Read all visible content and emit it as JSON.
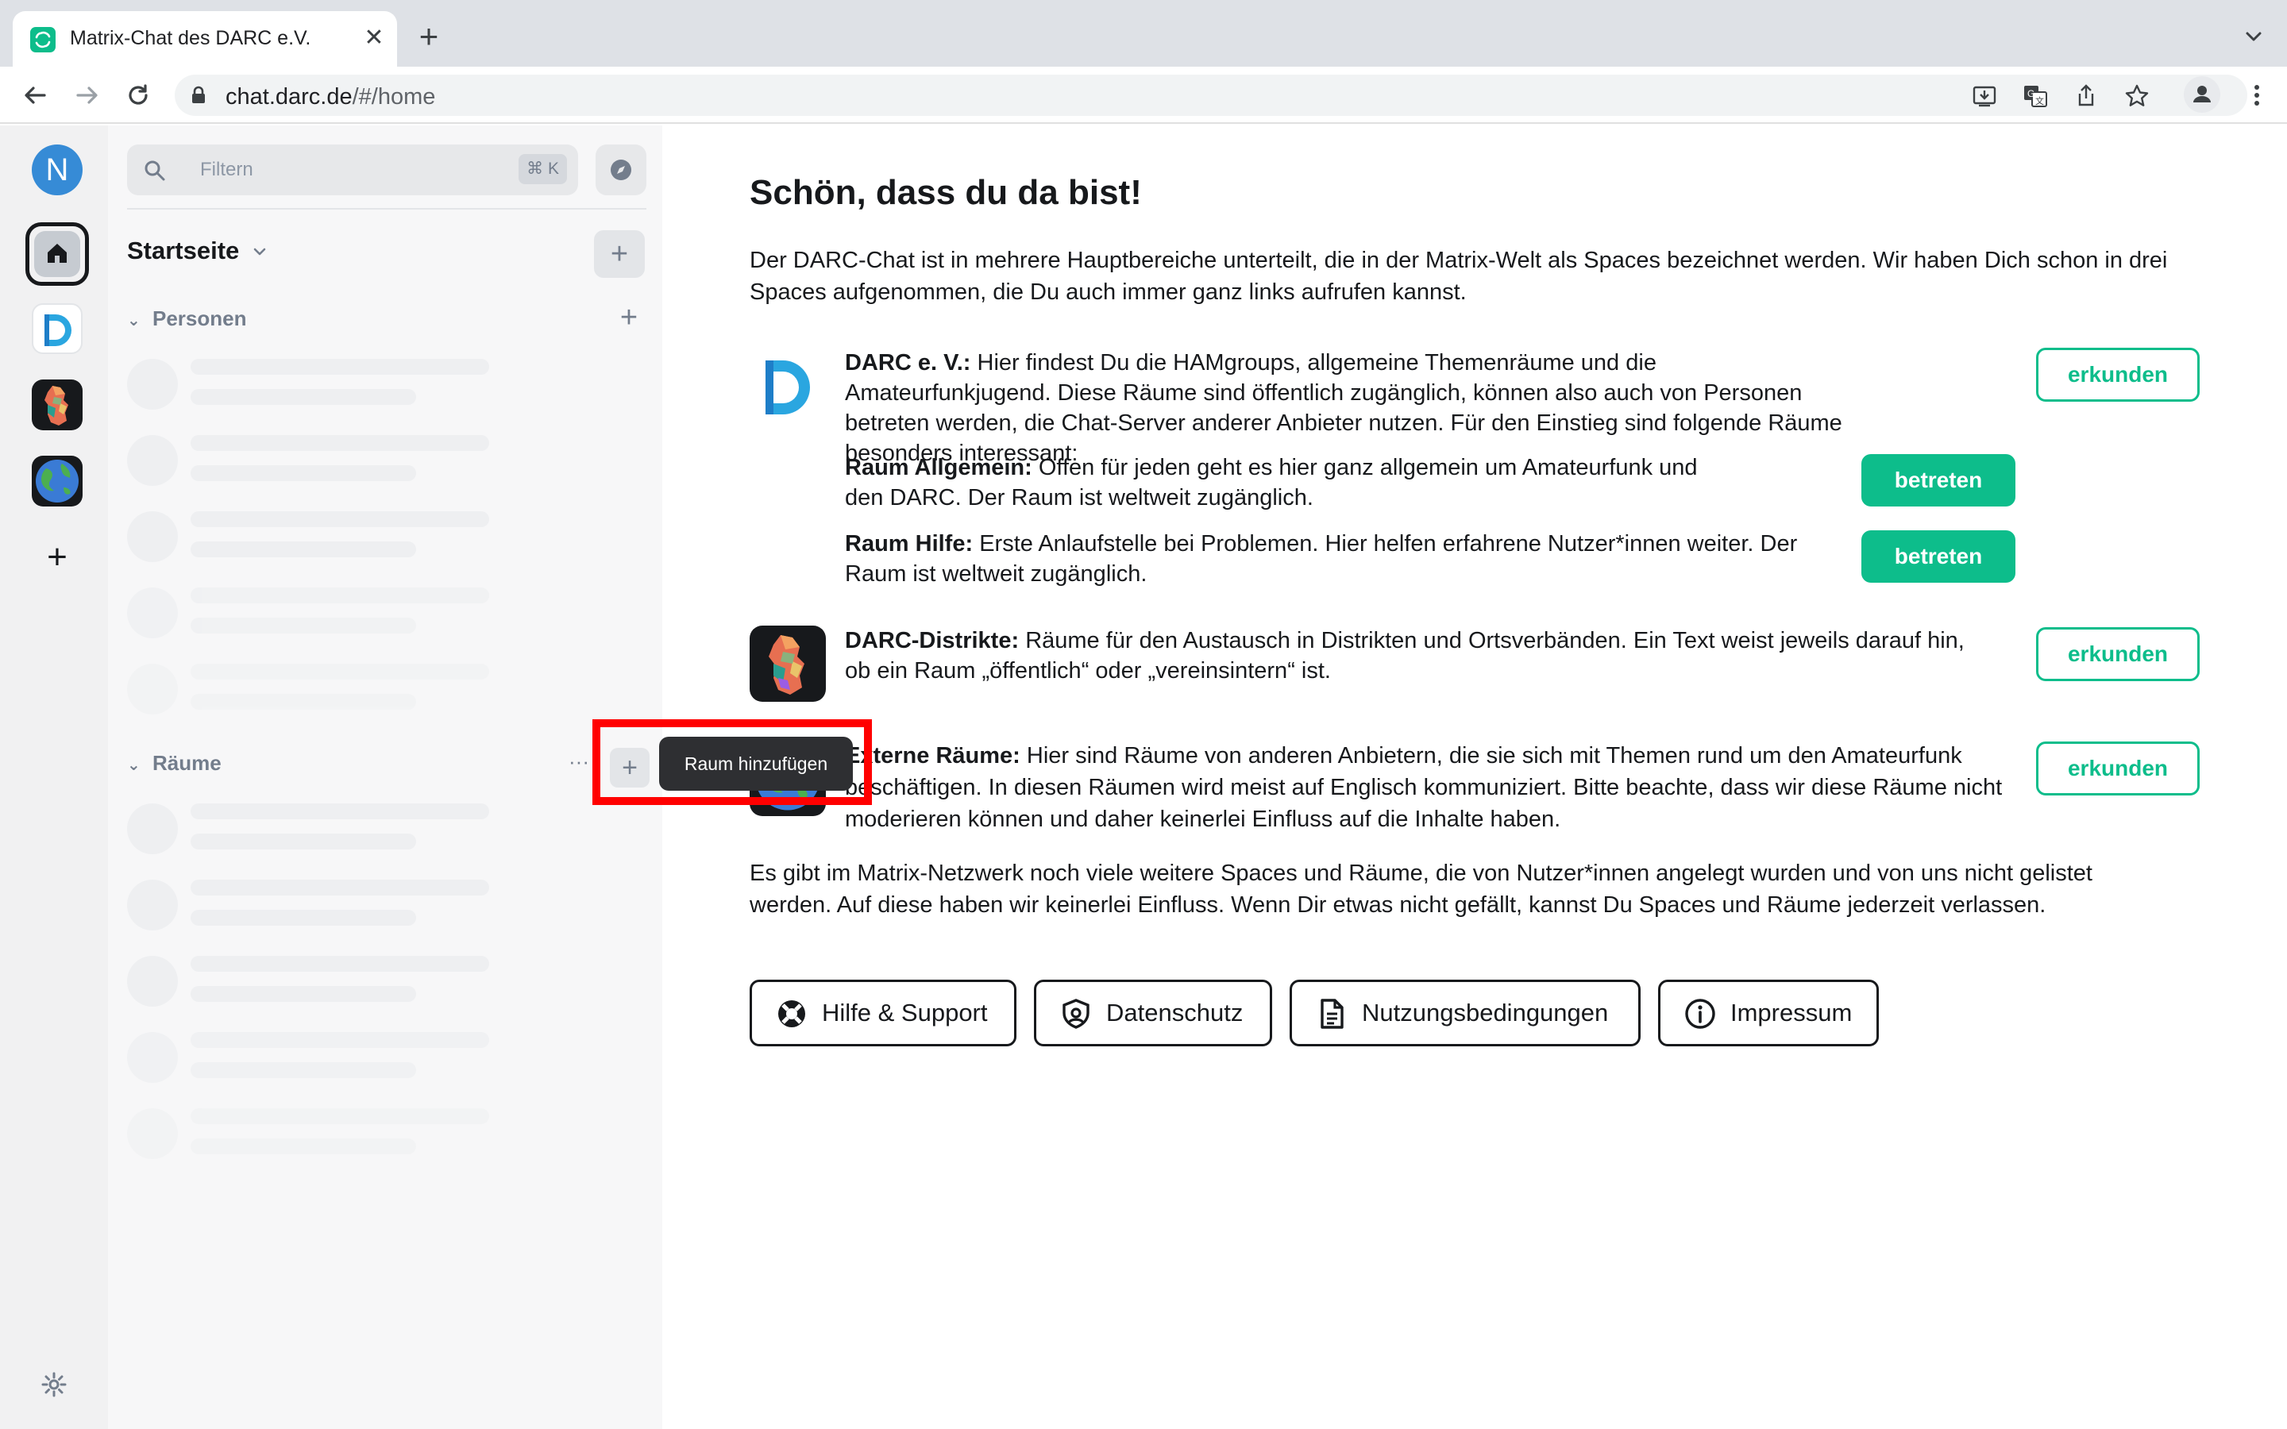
{
  "browser": {
    "tab_title": "Matrix-Chat des DARC e.V.",
    "tab_close": "✕",
    "new_tab": "+",
    "url_host": "chat.darc.de",
    "url_path": "/#/home"
  },
  "spacebar": {
    "user_initial": "N",
    "add_space": "+"
  },
  "roomlist": {
    "filter_placeholder": "Filtern",
    "filter_shortcut": "⌘ K",
    "home_title": "Startseite",
    "home_add": "+",
    "people_label": "Personen",
    "people_add": "+",
    "rooms_label": "Räume",
    "rooms_more": "···",
    "rooms_add": "+",
    "tooltip": "Raum hinzufügen"
  },
  "home": {
    "title": "Schön, dass du da bist!",
    "intro": "Der DARC-Chat ist in mehrere Hauptbereiche unterteilt, die in der Matrix-Welt als Spaces bezeichnet werden. Wir haben Dich schon in drei Spaces aufgenommen, die Du auch immer ganz links aufrufen kannst.",
    "darc": {
      "heading": "DARC e. V.:",
      "text": " Hier findest Du die HAMgroups, allgemeine Themenräume und die Amateurfunkjugend. Diese Räume sind öffentlich zugänglich, können also auch von Personen betreten werden, die Chat-Server anderer Anbieter nutzen. Für den Einstieg sind folgende Räume besonders interessant:",
      "button": "erkunden",
      "room1_heading": "Raum Allgemein:",
      "room1_text": " Offen für jeden geht es hier ganz allgemein um Amateurfunk und den DARC. Der Raum ist weltweit zugänglich.",
      "room1_button": "betreten",
      "room2_heading": "Raum Hilfe:",
      "room2_text": " Erste Anlaufstelle bei Problemen. Hier helfen erfahrene Nutzer*innen weiter. Der Raum ist weltweit zugänglich.",
      "room2_button": "betreten"
    },
    "districts": {
      "heading": "DARC-Distrikte:",
      "text": " Räume für den Austausch in Distrikten und Ortsverbänden. Ein Text weist jeweils darauf hin, ob ein Raum „öffentlich“ oder „vereinsintern“ ist.",
      "button": "erkunden"
    },
    "external": {
      "heading": "Externe Räume:",
      "text": " Hier sind Räume von anderen Anbietern, die sie sich mit Themen rund um den Amateurfunk beschäftigen. In diesen Räumen wird meist auf Englisch kommuniziert. Bitte beachte, dass wir diese Räume nicht moderieren können und daher keinerlei Einfluss auf die Inhalte haben.",
      "button": "erkunden"
    },
    "footer": "Es gibt im Matrix-Netzwerk noch viele weitere Spaces und Räume, die von Nutzer*innen angelegt wurden und von uns nicht gelistet werden. Auf diese haben wir keinerlei Einfluss. Wenn Dir etwas nicht gefällt, kannst Du Spaces und Räume jederzeit verlassen.",
    "links": {
      "help": "Hilfe & Support",
      "privacy": "Datenschutz",
      "terms": "Nutzungsbedingungen",
      "imprint": "Impressum"
    }
  },
  "colors": {
    "accent": "#0dbd8b",
    "highlight": "#ff0000",
    "avatar": "#368bd6"
  },
  "icons": [
    "back-icon",
    "forward-icon",
    "reload-icon",
    "lock-icon",
    "install-icon",
    "translate-icon",
    "share-icon",
    "star-icon",
    "profile-icon",
    "menu-icon",
    "home-icon",
    "search-icon",
    "explore-icon",
    "settings-icon",
    "lifebuoy-icon",
    "shield-icon",
    "document-icon",
    "info-icon"
  ]
}
